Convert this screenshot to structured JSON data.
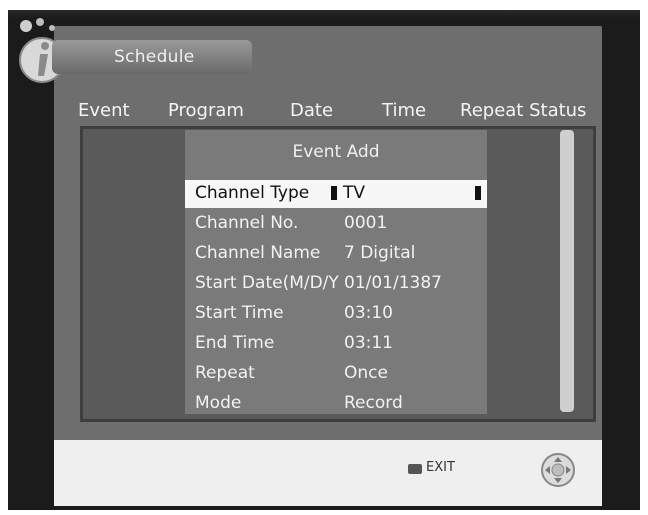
{
  "header": {
    "title": "Schedule"
  },
  "columns": [
    "Event",
    "Program",
    "Date",
    "Time",
    "Repeat Status"
  ],
  "dialog": {
    "title": "Event Add",
    "fields": [
      {
        "label": "Channel Type",
        "value": "TV"
      },
      {
        "label": "Channel No.",
        "value": "0001"
      },
      {
        "label": "Channel Name",
        "value": "7 Digital"
      },
      {
        "label": "Start Date(M/D/Y",
        "value": "01/01/1387"
      },
      {
        "label": "Start Time",
        "value": "03:10"
      },
      {
        "label": "End Time",
        "value": "03:11"
      },
      {
        "label": "Repeat",
        "value": "Once"
      },
      {
        "label": "Mode",
        "value": "Record"
      }
    ]
  },
  "footer": {
    "exit_key": "EXIT",
    "exit_label": "EXIT"
  },
  "icons": {
    "info": "info-icon",
    "nav": "nav-dpad-icon"
  },
  "colors": {
    "panel": "#6e6e6e",
    "dialog": "#7a7a7a",
    "selected_row": "#f7f7f7",
    "footer": "#efefef"
  }
}
